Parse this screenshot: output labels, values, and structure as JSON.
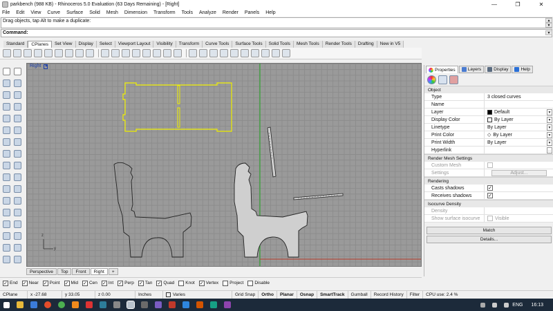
{
  "window": {
    "title": "parkbench (988 KB) - Rhinoceros 5.0 Evaluation (63 Days Remaining) - [Right]",
    "min": "—",
    "max": "❐",
    "close": "✕"
  },
  "menu": [
    "File",
    "Edit",
    "View",
    "Curve",
    "Surface",
    "Solid",
    "Mesh",
    "Dimension",
    "Transform",
    "Tools",
    "Analyze",
    "Render",
    "Panels",
    "Help"
  ],
  "command": {
    "history": "Drag objects, tap Alt to make a duplicate:",
    "prompt": "Command:"
  },
  "toolbar_tabs": [
    "Standard",
    "CPlanes",
    "Set View",
    "Display",
    "Select",
    "Viewport Layout",
    "Visibility",
    "Transform",
    "Curve Tools",
    "Surface Tools",
    "Solid Tools",
    "Mesh Tools",
    "Render Tools",
    "Drafting",
    "New in V5"
  ],
  "toolbar_active": "CPlanes",
  "viewport": {
    "title": "Right",
    "axis_y": "z",
    "axis_x": "y"
  },
  "view_tabs": [
    "Perspective",
    "Top",
    "Front",
    "Right"
  ],
  "view_tab_add": "+",
  "osnaps": [
    {
      "label": "End",
      "checked": true
    },
    {
      "label": "Near",
      "checked": true
    },
    {
      "label": "Point",
      "checked": true
    },
    {
      "label": "Mid",
      "checked": true
    },
    {
      "label": "Cen",
      "checked": true
    },
    {
      "label": "Int",
      "checked": true
    },
    {
      "label": "Perp",
      "checked": true
    },
    {
      "label": "Tan",
      "checked": true
    },
    {
      "label": "Quad",
      "checked": true
    },
    {
      "label": "Knot",
      "checked": false
    },
    {
      "label": "Vertex",
      "checked": true
    },
    {
      "label": "Project",
      "checked": false
    },
    {
      "label": "Disable",
      "checked": false
    }
  ],
  "status": {
    "cplane": "CPlane",
    "x": "x -27.68",
    "y": "y 33.05",
    "z": "z 0.00",
    "units": "Inches",
    "layer": "Varies",
    "grid_snap": "Grid Snap",
    "ortho": "Ortho",
    "planar": "Planar",
    "osnap": "Osnap",
    "smarttrack": "SmartTrack",
    "gumball": "Gumball",
    "record_history": "Record History",
    "filter": "Filter",
    "cpu": "CPU use: 2.4 %"
  },
  "panel": {
    "tabs": [
      "Properties",
      "Layers",
      "Display",
      "Help"
    ],
    "section_object": "Object",
    "object_rows": [
      {
        "k": "Type",
        "v": "3 closed curves"
      },
      {
        "k": "Name",
        "v": ""
      },
      {
        "k": "Layer",
        "v": "Default"
      },
      {
        "k": "Display Color",
        "v": "By Layer"
      },
      {
        "k": "Linetype",
        "v": "By Layer"
      },
      {
        "k": "Print Color",
        "v": "By Layer"
      },
      {
        "k": "Print Width",
        "v": "By Layer"
      },
      {
        "k": "Hyperlink",
        "v": ""
      }
    ],
    "section_rmesh": "Render Mesh Settings",
    "rmesh_rows": [
      {
        "k": "Custom Mesh"
      },
      {
        "k": "Settings",
        "btn": "Adjust..."
      }
    ],
    "section_render": "Rendering",
    "render_rows": [
      {
        "k": "Casts shadows"
      },
      {
        "k": "Receives shadows"
      }
    ],
    "section_iso": "Isocurve Density",
    "iso_rows": [
      {
        "k": "Density"
      },
      {
        "k": "Show surface isocurve",
        "v": "Visible"
      }
    ],
    "match": "Match",
    "details": "Details..."
  },
  "taskbar": {
    "lang": "ENG",
    "time": "16:13"
  }
}
